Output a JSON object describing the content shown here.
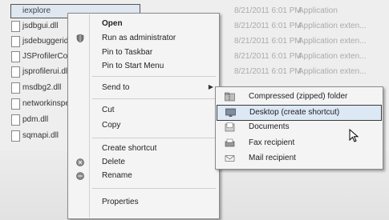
{
  "explorer": {
    "files": [
      {
        "name": "iexplore",
        "date": "8/21/2011 6:01 PM",
        "type": "Application",
        "selected": true
      },
      {
        "name": "jsdbgui.dll",
        "date": "8/21/2011 6:01 PM",
        "type": "Application exten..."
      },
      {
        "name": "jsdebuggeride",
        "date": "8/21/2011 6:01 PM",
        "type": "Application exten..."
      },
      {
        "name": "JSProfilerCore",
        "date": "8/21/2011 6:01 PM",
        "type": "Application exten..."
      },
      {
        "name": "jsprofilerui.dll",
        "date": "8/21/2011 6:01 PM",
        "type": "Application exten..."
      },
      {
        "name": "msdbg2.dll",
        "date": "",
        "type": ""
      },
      {
        "name": "networkinspe",
        "date": "",
        "type": ""
      },
      {
        "name": "pdm.dll",
        "date": "",
        "type": ""
      },
      {
        "name": "sqmapi.dll",
        "date": "",
        "type": ""
      }
    ]
  },
  "context_menu": {
    "open": "Open",
    "run_as_admin": "Run as administrator",
    "pin_taskbar": "Pin to Taskbar",
    "pin_start": "Pin to Start Menu",
    "send_to": "Send to",
    "cut": "Cut",
    "copy": "Copy",
    "create_shortcut": "Create shortcut",
    "delete": "Delete",
    "rename": "Rename",
    "properties": "Properties"
  },
  "send_to_menu": {
    "compressed": "Compressed (zipped) folder",
    "desktop": "Desktop (create shortcut)",
    "documents": "Documents",
    "fax": "Fax recipient",
    "mail": "Mail recipient"
  }
}
